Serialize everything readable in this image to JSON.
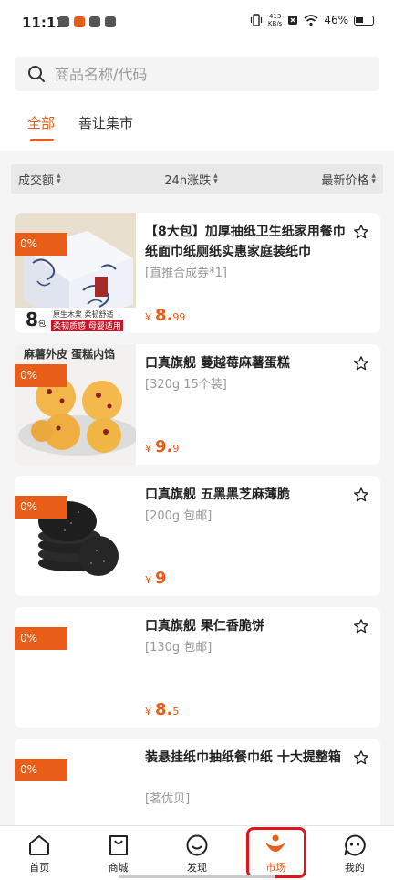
{
  "status": {
    "time": "11:11",
    "netspeed_value": "413",
    "netspeed_unit": "KB/s",
    "battery": "46%"
  },
  "search": {
    "placeholder": "商品名称/代码"
  },
  "tabs": [
    {
      "label": "全部",
      "active": true
    },
    {
      "label": "善让集市",
      "active": false
    }
  ],
  "sort": [
    {
      "label": "成交额"
    },
    {
      "label": "24h涨跌"
    },
    {
      "label": "最新价格"
    }
  ],
  "products": [
    {
      "badge": "0%",
      "title": "【8大包】加厚抽纸卫生纸家用餐巾纸面巾纸厕纸实惠家庭装纸巾",
      "subtitle": "[直推合成券*1]",
      "price_symbol": "¥",
      "price_int": "8.",
      "price_dec": "99",
      "image_text": {
        "pack_count": "8",
        "pack_unit": "包",
        "tag1": "原生木浆 柔韧舒适",
        "tag2": "柔韧质感 母婴适用"
      }
    },
    {
      "badge": "0%",
      "title": "口真旗舰 蔓越莓麻薯蛋糕",
      "subtitle": "[320g 15个装]",
      "price_symbol": "¥",
      "price_int": "9.",
      "price_dec": "9",
      "image_text": {
        "caption": "麻薯外皮 蛋糕内馅"
      }
    },
    {
      "badge": "0%",
      "title": "口真旗舰 五黑黑芝麻薄脆",
      "subtitle": "[200g 包邮]",
      "price_symbol": "¥",
      "price_int": "9",
      "price_dec": ""
    },
    {
      "badge": "0%",
      "title": "口真旗舰 果仁香脆饼",
      "subtitle": "[130g 包邮]",
      "price_symbol": "¥",
      "price_int": "8.",
      "price_dec": "5"
    },
    {
      "badge": "0%",
      "title": "装悬挂纸巾抽纸餐巾纸 十大提整箱",
      "subtitle": "[茗优贝]",
      "price_symbol": "",
      "price_int": "",
      "price_dec": ""
    }
  ],
  "nav": [
    {
      "label": "首页",
      "icon": "home-icon"
    },
    {
      "label": "商城",
      "icon": "shopping-bag-icon"
    },
    {
      "label": "发现",
      "icon": "smile-icon"
    },
    {
      "label": "市场",
      "icon": "market-icon",
      "active": true
    },
    {
      "label": "我的",
      "icon": "chat-face-icon"
    }
  ],
  "colors": {
    "accent": "#e85d1a",
    "highlight": "#e0151c"
  }
}
